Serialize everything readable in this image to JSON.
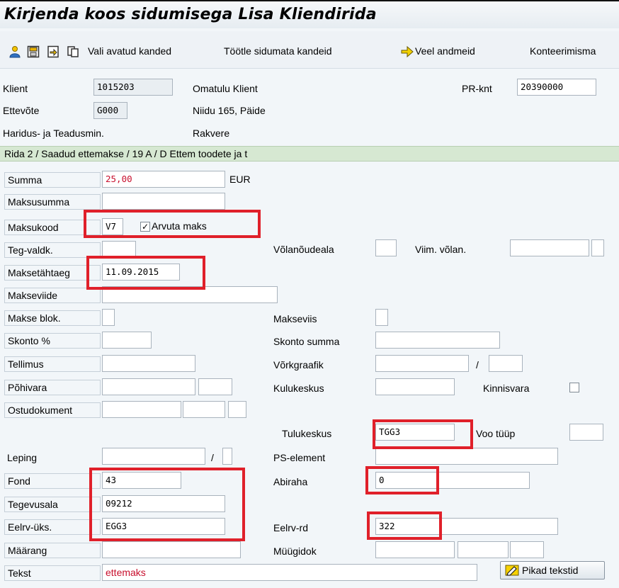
{
  "title": "Kirjenda koos sidumisega Lisa Kliendirida",
  "toolbar": {
    "icons": [
      "person-icon",
      "save-icon",
      "post-icon",
      "copy-icon"
    ],
    "vali_avatud": "Vali avatud kanded",
    "tootle": "Töötle sidumata kandeid",
    "veel": "Veel andmeid",
    "konteerimis": "Konteerimisma"
  },
  "header": {
    "klient_label": "Klient",
    "klient_value": "1015203",
    "klient_name": "Omatulu Klient",
    "prknt_label": "PR-knt",
    "prknt_value": "20390000",
    "ettevote_label": "Ettevõte",
    "ettevote_value": "G000",
    "address": "Niidu 165, Päide",
    "org": "Haridus- ja Teadusmin.",
    "city": "Rakvere"
  },
  "section": "Rida 2 / Saadud ettemakse / 19 A / D Ettem toodete ja t",
  "form": {
    "summa_label": "Summa",
    "summa_value": "25,00",
    "currency": "EUR",
    "maksusumma_label": "Maksusumma",
    "maksukood_label": "Maksukood",
    "maksukood_value": "V7",
    "arvuta_label": "Arvuta maks",
    "arvuta_checked": "✓",
    "tegvaldk_label": "Teg-valdk.",
    "volanoudeala_label": "Võlanõudeala",
    "viimvolan_label": "Viim. võlan.",
    "maksetahtaeg_label": "Maksetähtaeg",
    "maksetahtaeg_value": "11.09.2015",
    "makseviide_label": "Makseviide",
    "makseblok_label": "Makse blok.",
    "makseviis_label": "Makseviis",
    "skonto_label": "Skonto %",
    "skontosumma_label": "Skonto summa",
    "tellimus_label": "Tellimus",
    "vorkgraafik_label": "Võrkgraafik",
    "slash": "/",
    "pohivara_label": "Põhivara",
    "kulukeskus_label": "Kulukeskus",
    "kinnisvara_label": "Kinnisvara",
    "ostudokument_label": "Ostudokument",
    "tulukeskus_label": "Tulukeskus",
    "tulukeskus_value": "TGG3",
    "vootuup_label": "Voo tüüp",
    "leping_label": "Leping",
    "pselement_label": "PS-element",
    "fond_label": "Fond",
    "fond_value": "43",
    "abiraha_label": "Abiraha",
    "abiraha_value": "0",
    "tegevusala_label": "Tegevusala",
    "tegevusala_value": "09212",
    "eelrvuks_label": "Eelrv-üks.",
    "eelrvuks_value": "EGG3",
    "eelrvrd_label": "Eelrv-rd",
    "eelrvrd_value": "322",
    "marang_label": "Määrang",
    "muugidok_label": "Müügidok",
    "tekst_label": "Tekst",
    "tekst_value": "ettemaks",
    "pikad_label": "Pikad tekstid"
  },
  "colors": {
    "highlight": "#e0202a",
    "section": "#d6e8d2",
    "value_red": "#c8102e"
  }
}
